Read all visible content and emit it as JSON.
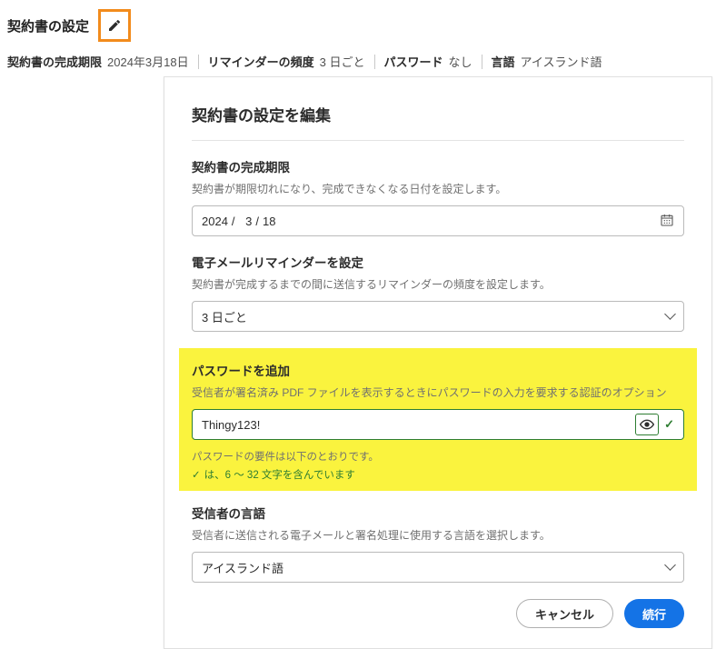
{
  "page": {
    "title": "契約書の設定"
  },
  "summary": {
    "deadline_label": "契約書の完成期限",
    "deadline_value": "2024年3月18日",
    "reminder_label": "リマインダーの頻度",
    "reminder_value": "3 日ごと",
    "password_label": "パスワード",
    "password_value": "なし",
    "language_label": "言語",
    "language_value": "アイスランド語"
  },
  "dialog": {
    "title": "契約書の設定を編集",
    "deadline": {
      "label": "契約書の完成期限",
      "desc": "契約書が期限切れになり、完成できなくなる日付を設定します。",
      "year": "2024",
      "month": "3",
      "day": "18"
    },
    "reminder": {
      "label": "電子メールリマインダーを設定",
      "desc": "契約書が完成するまでの間に送信するリマインダーの頻度を設定します。",
      "value": "3 日ごと"
    },
    "password": {
      "label": "パスワードを追加",
      "desc": "受信者が署名済み PDF ファイルを表示するときにパスワードの入力を要求する認証のオプション",
      "value": "Thingy123!",
      "req_header": "パスワードの要件は以下のとおりです。",
      "req_ok": "は、6 ～ 32 文字を含んでいます"
    },
    "language": {
      "label": "受信者の言語",
      "desc": "受信者に送信される電子メールと署名処理に使用する言語を選択します。",
      "value": "アイスランド語"
    },
    "buttons": {
      "cancel": "キャンセル",
      "continue": "続行"
    }
  }
}
